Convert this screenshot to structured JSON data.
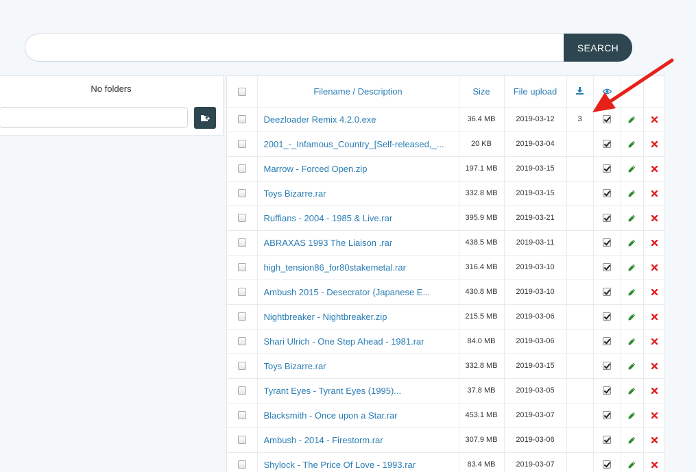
{
  "search": {
    "placeholder": "",
    "value": "",
    "button_label": "SEARCH"
  },
  "folders": {
    "empty_label": "No folders",
    "new_folder_value": ""
  },
  "table": {
    "headers": {
      "filename": "Filename / Description",
      "size": "Size",
      "upload": "File upload",
      "download_icon": "download-icon",
      "visible_icon": "eye-icon"
    },
    "rows": [
      {
        "name": "Deezloader Remix 4.2.0.exe",
        "size": "36.4 MB",
        "date": "2019-03-12",
        "downloads": "3"
      },
      {
        "name": "2001_-_Infamous_Country_[Self-released,_...",
        "size": "20 KB",
        "date": "2019-03-04",
        "downloads": ""
      },
      {
        "name": "Marrow - Forced Open.zip",
        "size": "197.1 MB",
        "date": "2019-03-15",
        "downloads": ""
      },
      {
        "name": "Toys Bizarre.rar",
        "size": "332.8 MB",
        "date": "2019-03-15",
        "downloads": ""
      },
      {
        "name": "Ruffians - 2004 - 1985 & Live.rar",
        "size": "395.9 MB",
        "date": "2019-03-21",
        "downloads": ""
      },
      {
        "name": "ABRAXAS 1993 The Liaison .rar",
        "size": "438.5 MB",
        "date": "2019-03-11",
        "downloads": ""
      },
      {
        "name": "high_tension86_for80stakemetal.rar",
        "size": "316.4 MB",
        "date": "2019-03-10",
        "downloads": ""
      },
      {
        "name": "Ambush 2015 - Desecrator (Japanese E...",
        "size": "430.8 MB",
        "date": "2019-03-10",
        "downloads": ""
      },
      {
        "name": "Nightbreaker - Nightbreaker.zip",
        "size": "215.5 MB",
        "date": "2019-03-06",
        "downloads": ""
      },
      {
        "name": "Shari Ulrich - One Step Ahead - 1981.rar",
        "size": "84.0 MB",
        "date": "2019-03-06",
        "downloads": ""
      },
      {
        "name": "Toys Bizarre.rar",
        "size": "332.8 MB",
        "date": "2019-03-15",
        "downloads": ""
      },
      {
        "name": "Tyrant Eyes - Tyrant Eyes (1995)...",
        "size": "37.8 MB",
        "date": "2019-03-05",
        "downloads": ""
      },
      {
        "name": "Blacksmith - Once upon a Star.rar",
        "size": "453.1 MB",
        "date": "2019-03-07",
        "downloads": ""
      },
      {
        "name": "Ambush - 2014 - Firestorm.rar",
        "size": "307.9 MB",
        "date": "2019-03-06",
        "downloads": ""
      },
      {
        "name": "Shylock - The Price Of Love - 1993.rar",
        "size": "83.4 MB",
        "date": "2019-03-07",
        "downloads": ""
      }
    ]
  },
  "colors": {
    "accent": "#2e4650",
    "link": "#2a7db4",
    "edit": "#2e8b2e",
    "delete": "#e02020",
    "annotation_arrow": "#e8201a"
  }
}
